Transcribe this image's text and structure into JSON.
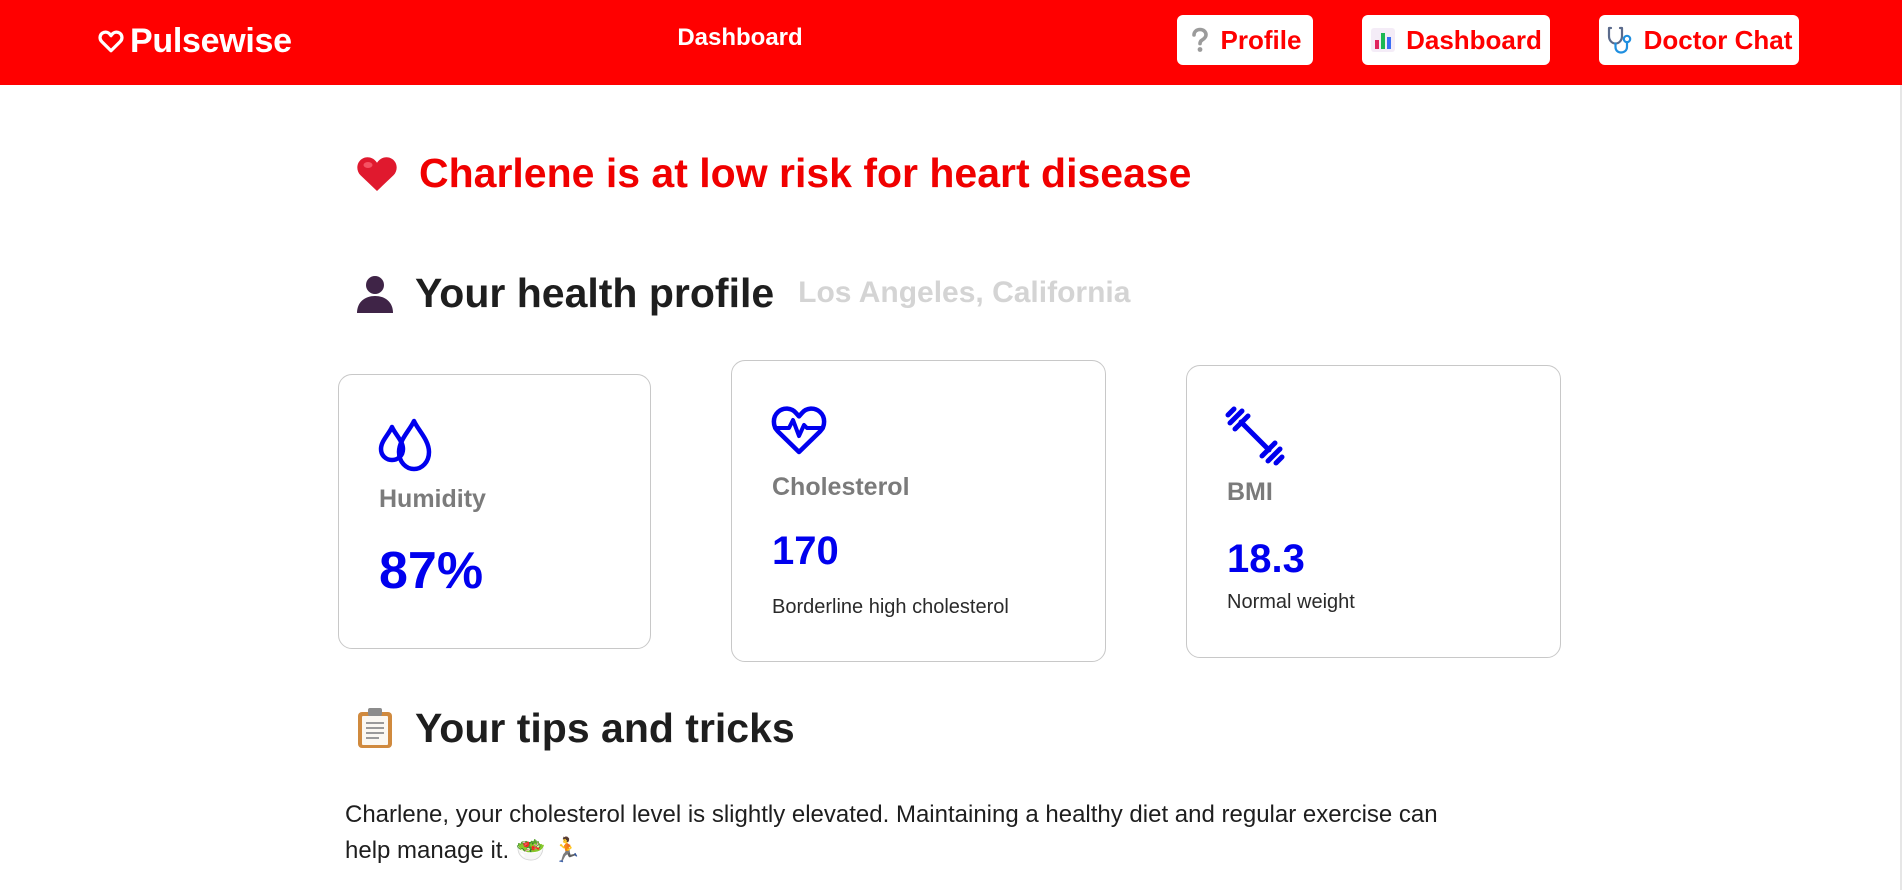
{
  "app": {
    "name": "Pulsewise",
    "page_title": "Dashboard",
    "brand_color": "#ff0000",
    "accent_color": "#0000ee"
  },
  "nav": {
    "profile": {
      "label": "Profile",
      "icon": "question-mark-icon"
    },
    "dashboard": {
      "label": "Dashboard",
      "icon": "bar-chart-icon"
    },
    "doctor_chat": {
      "label": "Doctor Chat",
      "icon": "stethoscope-icon"
    }
  },
  "risk": {
    "headline": "Charlene is at low risk for heart disease",
    "icon": "red-heart-icon"
  },
  "profile": {
    "title": "Your health profile",
    "location": "Los Angeles, California",
    "icon": "person-silhouette-icon",
    "cards": {
      "humidity": {
        "label": "Humidity",
        "value": "87%",
        "icon": "droplets-icon"
      },
      "cholesterol": {
        "label": "Cholesterol",
        "value": "170",
        "note": "Borderline high cholesterol",
        "icon": "heart-pulse-icon"
      },
      "bmi": {
        "label": "BMI",
        "value": "18.3",
        "note": "Normal weight",
        "icon": "dumbbell-icon"
      }
    }
  },
  "tips": {
    "title": "Your tips and tricks",
    "icon": "clipboard-icon",
    "text": "Charlene, your cholesterol level is slightly elevated. Maintaining a healthy diet and regular exercise can help manage it.",
    "emojis": "🥗 🏃"
  }
}
